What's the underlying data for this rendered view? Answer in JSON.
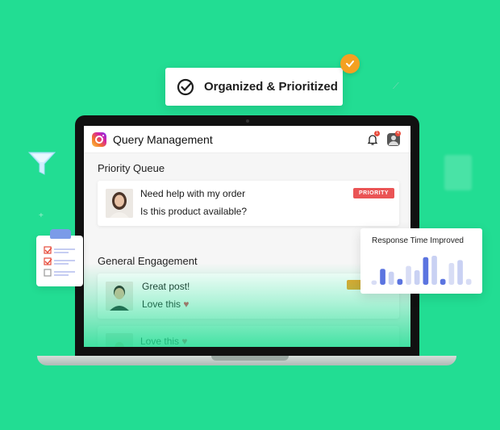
{
  "banner": {
    "text": "Organized & Prioritized",
    "icon": "check-circle-icon"
  },
  "app": {
    "title": "Query Management",
    "header_icons": [
      "instagram-icon",
      "bell-icon",
      "profile-icon"
    ],
    "notification_counts": {
      "bell": "1",
      "profile": "4"
    }
  },
  "priority_queue": {
    "title": "Priority Queue",
    "card": {
      "line1": "Need help with my order",
      "line2": "Is this product available?",
      "tag": "PRIORITY",
      "tag_color": "#ea5455"
    }
  },
  "general": {
    "title": "General Engagement",
    "card": {
      "line1": "Great post!",
      "line2": "Love this",
      "tag_color": "#f4a021"
    },
    "card2": {
      "line1": "Love this"
    }
  },
  "response_card": {
    "title": "Response Time Improved",
    "bar_values": [
      0.15,
      0.55,
      0.45,
      0.2,
      0.65,
      0.5,
      0.95,
      1.0,
      0.2,
      0.75,
      0.85,
      0.2
    ],
    "bar_colors": [
      "#d8ddf5",
      "#5b74e0",
      "#c9d1f3",
      "#5b74e0",
      "#d8ddf5",
      "#c9d1f3",
      "#5b74e0",
      "#c9d1f3",
      "#5b74e0",
      "#d8ddf5",
      "#c9d1f3",
      "#d8ddf5"
    ]
  },
  "colors": {
    "background": "#22dd93",
    "accent_orange": "#f4a021",
    "heart": "#e53950"
  }
}
